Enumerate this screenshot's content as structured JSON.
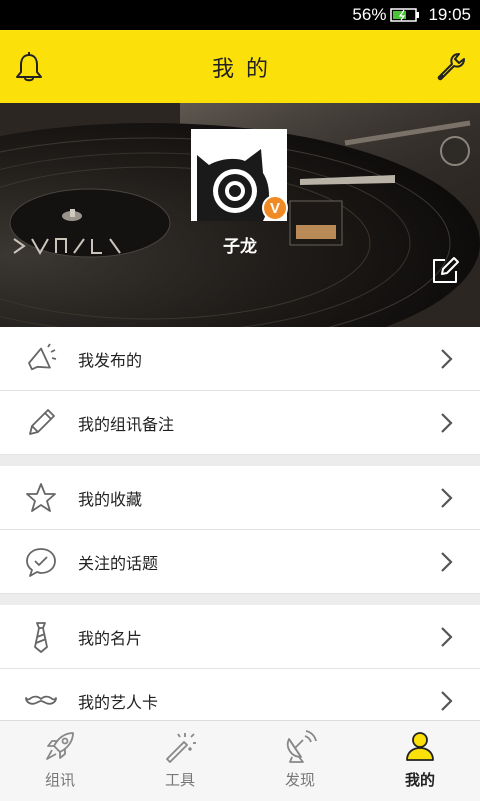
{
  "status_bar": {
    "battery_percent": "56%",
    "time": "19:05"
  },
  "header": {
    "title": "我的"
  },
  "profile": {
    "username": "子龙",
    "verified_badge": "V"
  },
  "menu_groups": [
    [
      {
        "label": "我发布的",
        "icon": "megaphone-icon"
      },
      {
        "label": "我的组讯备注",
        "icon": "pencil-icon"
      }
    ],
    [
      {
        "label": "我的收藏",
        "icon": "star-icon"
      },
      {
        "label": "关注的话题",
        "icon": "chat-check-icon"
      }
    ],
    [
      {
        "label": "我的名片",
        "icon": "tie-icon"
      },
      {
        "label": "我的艺人卡",
        "icon": "mustache-icon"
      }
    ]
  ],
  "bottom_nav": [
    {
      "label": "组讯",
      "icon": "rocket-icon",
      "active": false
    },
    {
      "label": "工具",
      "icon": "magic-wand-icon",
      "active": false
    },
    {
      "label": "发现",
      "icon": "satellite-dish-icon",
      "active": false
    },
    {
      "label": "我的",
      "icon": "person-icon",
      "active": true
    }
  ],
  "colors": {
    "accent": "#fce009",
    "badge": "#f08a24"
  }
}
